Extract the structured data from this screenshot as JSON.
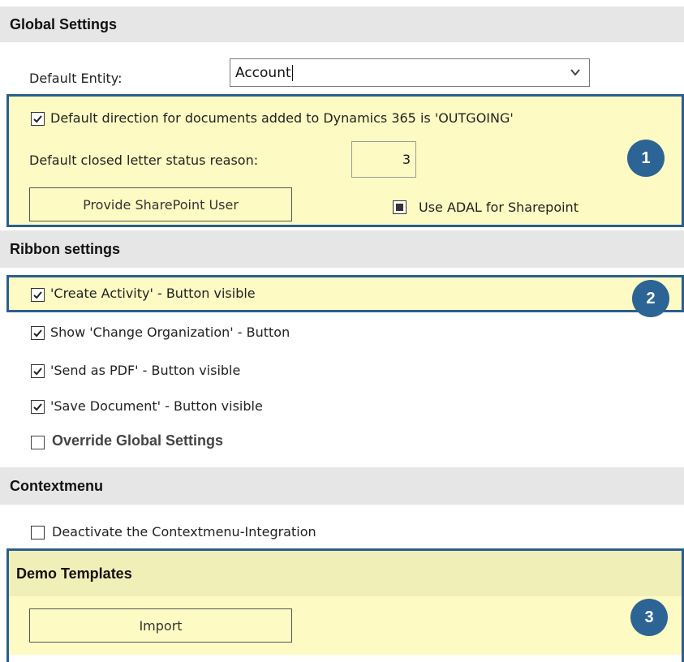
{
  "global_settings": {
    "header": "Global Settings",
    "default_entity_label": "Default Entity:",
    "default_entity_value": "Account",
    "direction_checkbox_label": "Default direction for documents added to Dynamics 365 is 'OUTGOING'",
    "closed_status_label": "Default closed letter status reason:",
    "closed_status_value": "3",
    "provide_sharepoint_button": "Provide SharePoint User",
    "adal_checkbox_label": "Use ADAL for Sharepoint",
    "badge": "1"
  },
  "ribbon_settings": {
    "header": "Ribbon settings",
    "items": [
      {
        "label": "'Create Activity' - Button visible",
        "checked": true
      },
      {
        "label": "Show 'Change Organization' - Button",
        "checked": true
      },
      {
        "label": "'Send as PDF' - Button visible",
        "checked": true
      },
      {
        "label": "'Save Document' - Button visible",
        "checked": true
      },
      {
        "label": "Override Global Settings",
        "checked": false
      }
    ],
    "badge": "2"
  },
  "contextmenu": {
    "header": "Contextmenu",
    "deactivate_label": "Deactivate the Contextmenu-Integration"
  },
  "demo_templates": {
    "header": "Demo Templates",
    "import_button": "Import",
    "badge": "3"
  },
  "colors": {
    "highlight": "#fdfbc3",
    "highlight_border": "#2a5f8e",
    "badge": "#2c6496",
    "section_header": "#e6e6e6"
  }
}
